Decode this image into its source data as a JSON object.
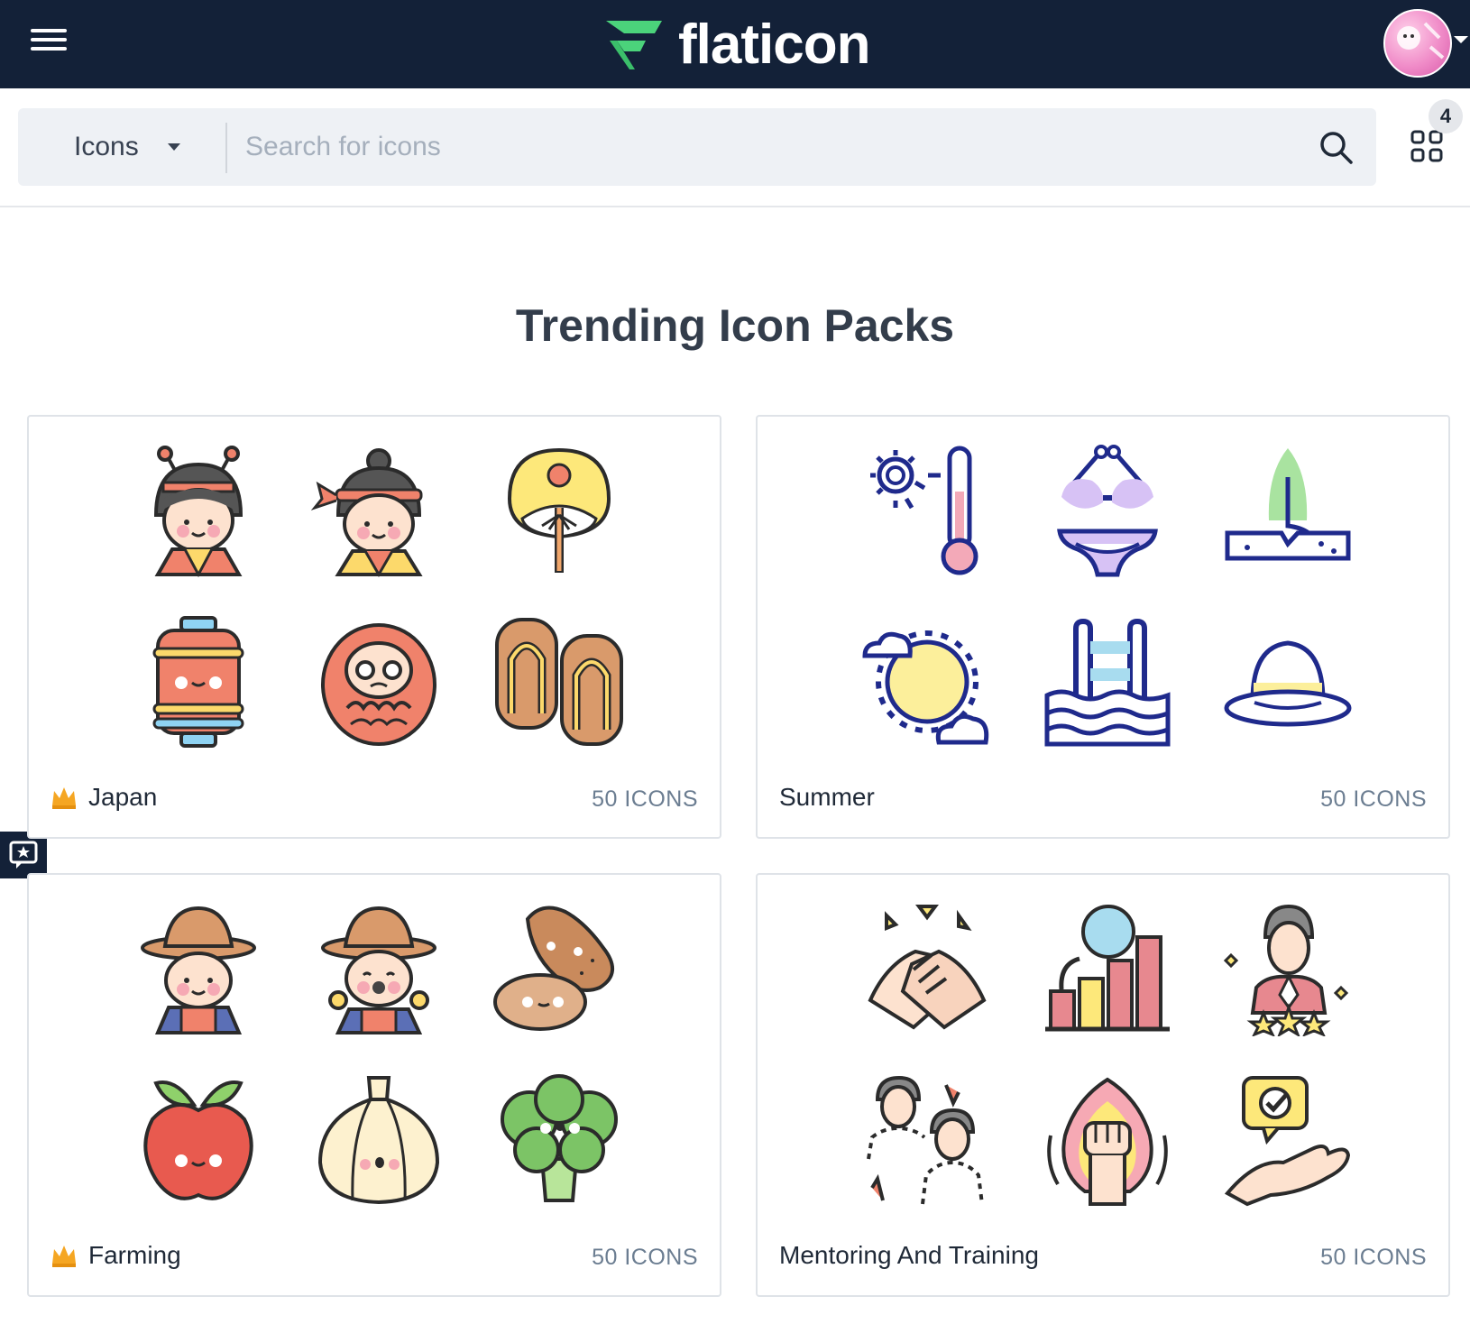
{
  "header": {
    "menu_label": "menu",
    "logo_text": "flaticon",
    "brand_colors": {
      "bar": "#132138",
      "logo_mark": "#4bd37b"
    }
  },
  "search": {
    "type_selected": "Icons",
    "placeholder": "Search for icons",
    "collections_count": "4"
  },
  "section": {
    "title": "Trending Icon Packs"
  },
  "packs": [
    {
      "name": "Japan",
      "count": "50 ICONS",
      "premium": true,
      "icons": [
        "geisha-icon",
        "ninja-girl-icon",
        "paper-fan-icon",
        "paper-lantern-icon",
        "daruma-doll-icon",
        "geta-sandals-icon"
      ]
    },
    {
      "name": "Summer",
      "count": "50 ICONS",
      "premium": false,
      "icons": [
        "hot-thermometer-icon",
        "bikini-icon",
        "surfboard-sand-icon",
        "sun-clouds-icon",
        "swimming-pool-icon",
        "summer-hat-icon"
      ]
    },
    {
      "name": "Farming",
      "count": "50 ICONS",
      "premium": true,
      "icons": [
        "farmer-boy-icon",
        "farmer-girl-icon",
        "potato-icon",
        "apple-icon",
        "garlic-icon",
        "broccoli-icon"
      ]
    },
    {
      "name": "Mentoring And Training",
      "count": "50 ICONS",
      "premium": false,
      "icons": [
        "handshake-icon",
        "growth-chart-icon",
        "employee-stars-icon",
        "mentor-exchange-icon",
        "power-fist-icon",
        "approval-hand-icon"
      ]
    }
  ]
}
